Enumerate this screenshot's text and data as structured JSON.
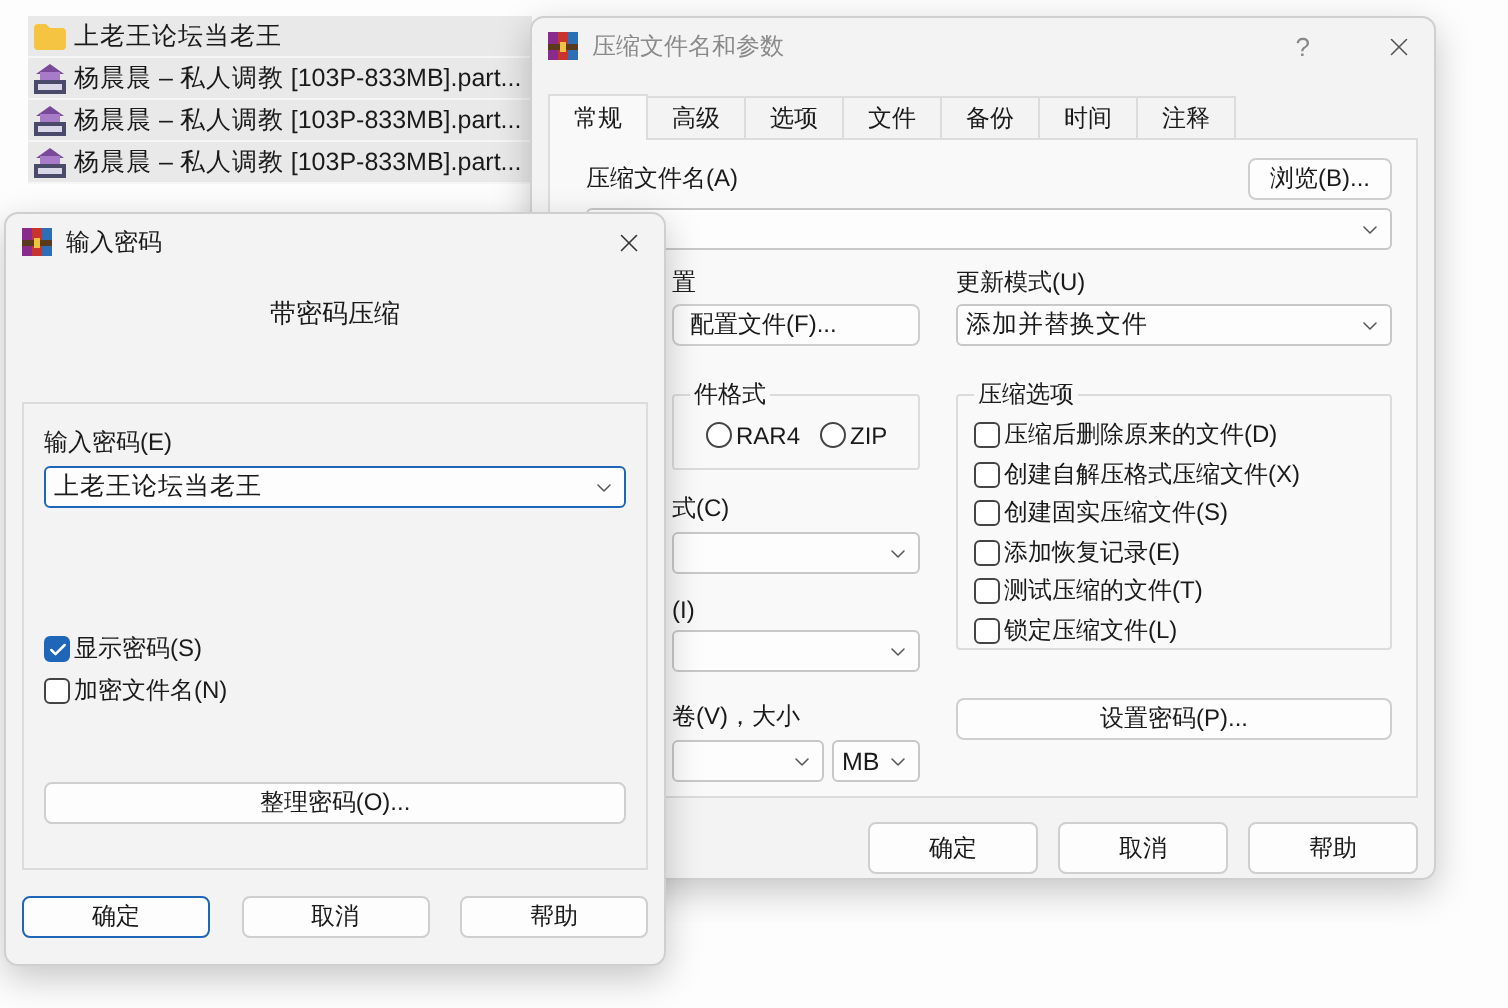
{
  "file_list": {
    "items": [
      {
        "kind": "folder",
        "name": "上老王论坛当老王"
      },
      {
        "kind": "archive",
        "name": "杨晨晨 – 私人调教 [103P-833MB].part..."
      },
      {
        "kind": "archive",
        "name": "杨晨晨 – 私人调教 [103P-833MB].part..."
      },
      {
        "kind": "archive",
        "name": "杨晨晨 – 私人调教 [103P-833MB].part..."
      }
    ]
  },
  "archive_dialog": {
    "title": "压缩文件名和参数",
    "active": false,
    "help": "?",
    "tabs": [
      {
        "label": "常规",
        "selected": true
      },
      {
        "label": "高级",
        "selected": false
      },
      {
        "label": "选项",
        "selected": false
      },
      {
        "label": "文件",
        "selected": false
      },
      {
        "label": "备份",
        "selected": false
      },
      {
        "label": "时间",
        "selected": false
      },
      {
        "label": "注释",
        "selected": false
      }
    ],
    "archive_name_label": "压缩文件名(A)",
    "browse_button": "浏览(B)...",
    "profile_label": "置",
    "profile_button": "配置文件(F)...",
    "update_mode_label": "更新模式(U)",
    "update_mode_value": "添加并替换文件",
    "format_group": {
      "title": "件格式",
      "options": [
        {
          "label": "RAR4",
          "selected": false
        },
        {
          "label": "ZIP",
          "selected": false
        }
      ]
    },
    "options_group": {
      "title": "压缩选项",
      "options": [
        {
          "label": "压缩后删除原来的文件(D)",
          "checked": false
        },
        {
          "label": "创建自解压格式压缩文件(X)",
          "checked": false
        },
        {
          "label": "创建固实压缩文件(S)",
          "checked": false
        },
        {
          "label": "添加恢复记录(E)",
          "checked": false
        },
        {
          "label": "测试压缩的文件(T)",
          "checked": false
        },
        {
          "label": "锁定压缩文件(L)",
          "checked": false
        }
      ]
    },
    "method_label": "式(C)",
    "dictionary_label": "(I)",
    "split_label": "卷(V)，大小",
    "split_unit": "MB",
    "set_password_button": "设置密码(P)...",
    "buttons": [
      {
        "label": "确定",
        "default": false
      },
      {
        "label": "取消",
        "default": false
      },
      {
        "label": "帮助",
        "default": false
      }
    ]
  },
  "password_dialog": {
    "title": "输入密码",
    "active": true,
    "heading": "带密码压缩",
    "password_label": "输入密码(E)",
    "password_value": "上老王论坛当老王",
    "options": [
      {
        "label": "显示密码(S)",
        "checked": true
      },
      {
        "label": "加密文件名(N)",
        "checked": false
      }
    ],
    "organize_button": "整理密码(O)...",
    "buttons": [
      {
        "label": "确定",
        "default": true
      },
      {
        "label": "取消",
        "default": false
      },
      {
        "label": "帮助",
        "default": false
      }
    ]
  }
}
